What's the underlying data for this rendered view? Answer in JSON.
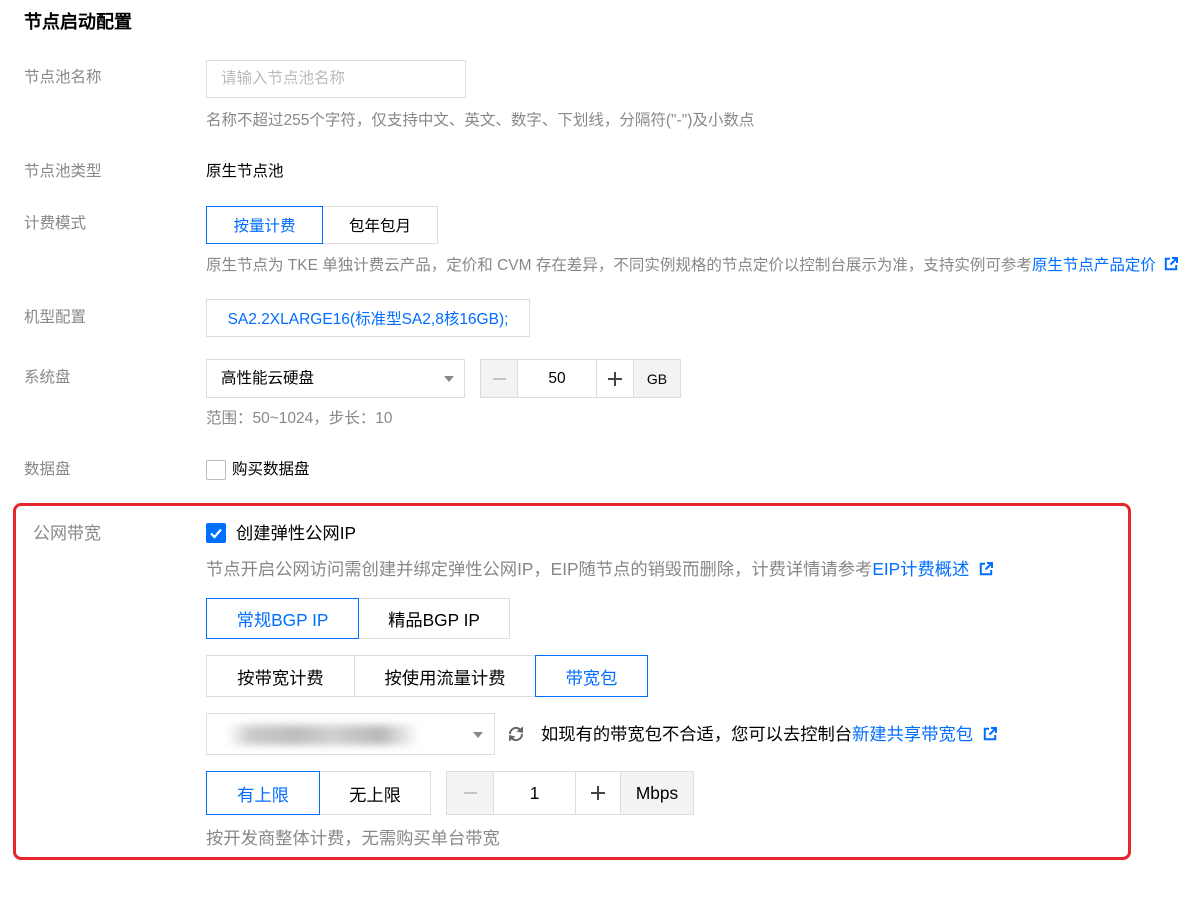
{
  "theme": {
    "primary": "#006eff",
    "label": "#888888",
    "highlight_border": "#e5262c"
  },
  "icons": {
    "external_link": "external-link-icon",
    "refresh": "refresh-icon",
    "dropdown": "caret-down-icon",
    "check": "check-icon",
    "decrement": "minus-icon",
    "increment": "plus-icon"
  },
  "section_title": "节点启动配置",
  "form": {
    "pool_name": {
      "label": "节点池名称",
      "placeholder": "请输入节点池名称",
      "value": "",
      "help": "名称不超过255个字符，仅支持中文、英文、数字、下划线，分隔符(\"-\")及小数点"
    },
    "pool_type": {
      "label": "节点池类型",
      "value": "原生节点池"
    },
    "billing_mode": {
      "label": "计费模式",
      "options": [
        {
          "label": "按量计费",
          "selected": true
        },
        {
          "label": "包年包月",
          "selected": false
        }
      ],
      "help_text": "原生节点为 TKE 单独计费云产品，定价和 CVM 存在差异，不同实例规格的节点定价以控制台展示为准，支持实例可参考",
      "help_link": "原生节点产品定价"
    },
    "instance_type": {
      "label": "机型配置",
      "value": "SA2.2XLARGE16(标准型SA2,8核16GB);"
    },
    "system_disk": {
      "label": "系统盘",
      "disk_type": "高性能云硬盘",
      "size": "50",
      "unit": "GB",
      "help": "范围：50~1024，步长：10"
    },
    "data_disk": {
      "label": "数据盘",
      "checkbox_label": "购买数据盘",
      "checked": false
    },
    "public_bandwidth": {
      "label": "公网带宽",
      "eip_checkbox_label": "创建弹性公网IP",
      "eip_checked": true,
      "eip_help_text": "节点开启公网访问需创建并绑定弹性公网IP，EIP随节点的销毁而删除，计费详情请参考",
      "eip_help_link": "EIP计费概述",
      "line_types": [
        {
          "label": "常规BGP IP",
          "selected": true
        },
        {
          "label": "精品BGP IP",
          "selected": false
        }
      ],
      "billing_types": [
        {
          "label": "按带宽计费",
          "selected": false
        },
        {
          "label": "按使用流量计费",
          "selected": false
        },
        {
          "label": "带宽包",
          "selected": true
        }
      ],
      "package_hint_text": "如现有的带宽包不合适，您可以去控制台",
      "package_hint_link": "新建共享带宽包",
      "limit_options": [
        {
          "label": "有上限",
          "selected": true
        },
        {
          "label": "无上限",
          "selected": false
        }
      ],
      "bandwidth_value": "1",
      "bandwidth_unit": "Mbps",
      "help": "按开发商整体计费，无需购买单台带宽"
    }
  }
}
